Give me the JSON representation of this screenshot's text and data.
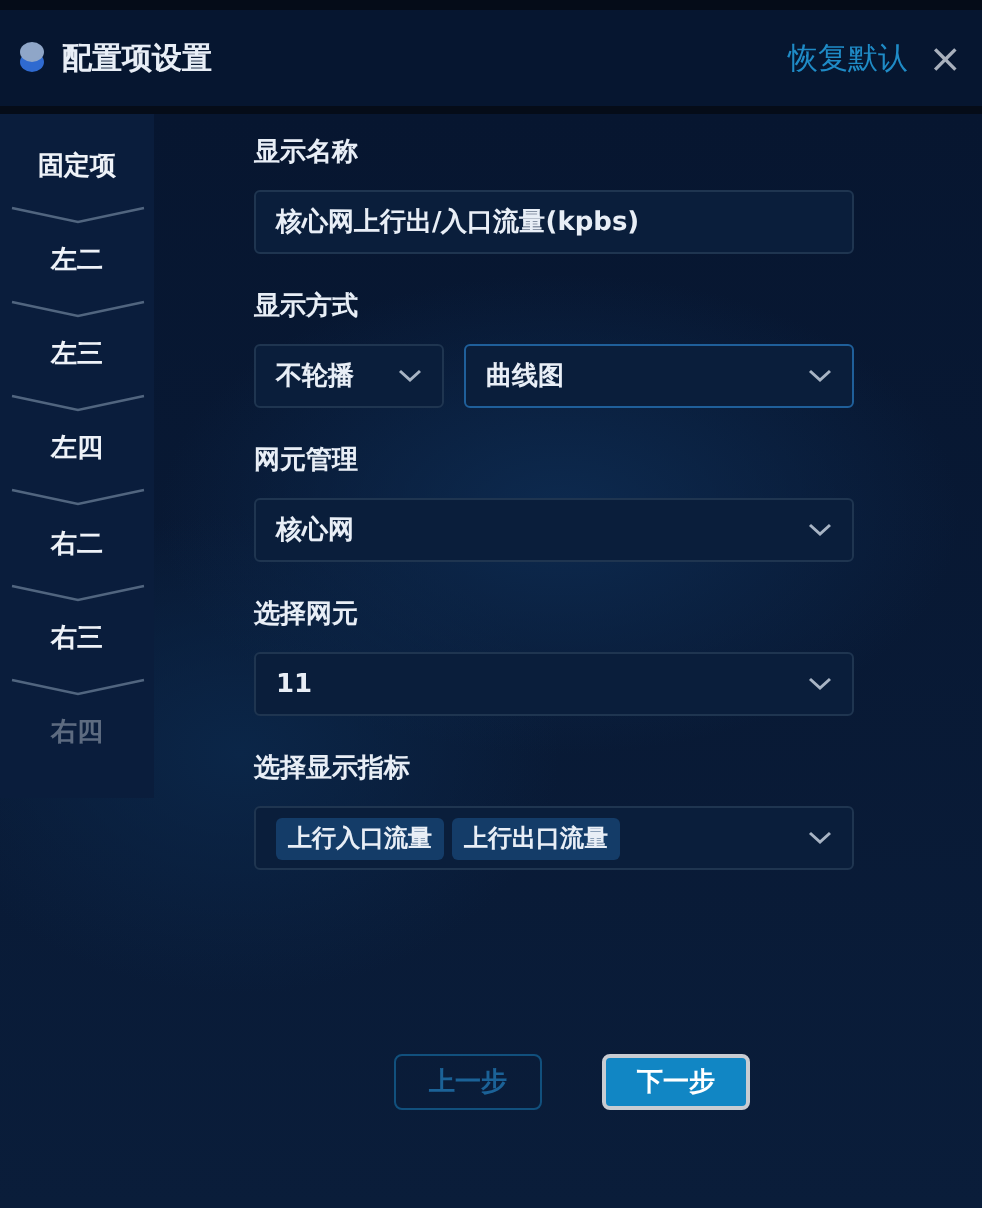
{
  "header": {
    "title": "配置项设置",
    "reset": "恢复默认",
    "close": "×"
  },
  "steps": [
    {
      "label": "固定项",
      "disabled": false
    },
    {
      "label": "左二",
      "disabled": false
    },
    {
      "label": "左三",
      "disabled": false
    },
    {
      "label": "左四",
      "disabled": false
    },
    {
      "label": "右二",
      "disabled": false
    },
    {
      "label": "右三",
      "disabled": false
    },
    {
      "label": "右四",
      "disabled": true
    }
  ],
  "form": [
    {
      "kind": "input",
      "label": "显示名称",
      "value": "核心网上行出/入口流量(kpbs)"
    },
    {
      "kind": "pair",
      "label": "显示方式",
      "selects": [
        {
          "value": "不轮播",
          "focused": false
        },
        {
          "value": "曲线图",
          "focused": true
        }
      ]
    },
    {
      "kind": "select",
      "label": "网元管理",
      "value": "核心网",
      "focused": false
    },
    {
      "kind": "select",
      "label": "选择网元",
      "value": "11",
      "focused": false
    },
    {
      "kind": "tags",
      "label": "选择显示指标",
      "tags": [
        "上行入口流量",
        "上行出口流量"
      ]
    }
  ],
  "buttons": [
    {
      "label": "上一步",
      "kind": "secondary",
      "disabled": true
    },
    {
      "label": "下一步",
      "kind": "primary",
      "disabled": false
    }
  ]
}
